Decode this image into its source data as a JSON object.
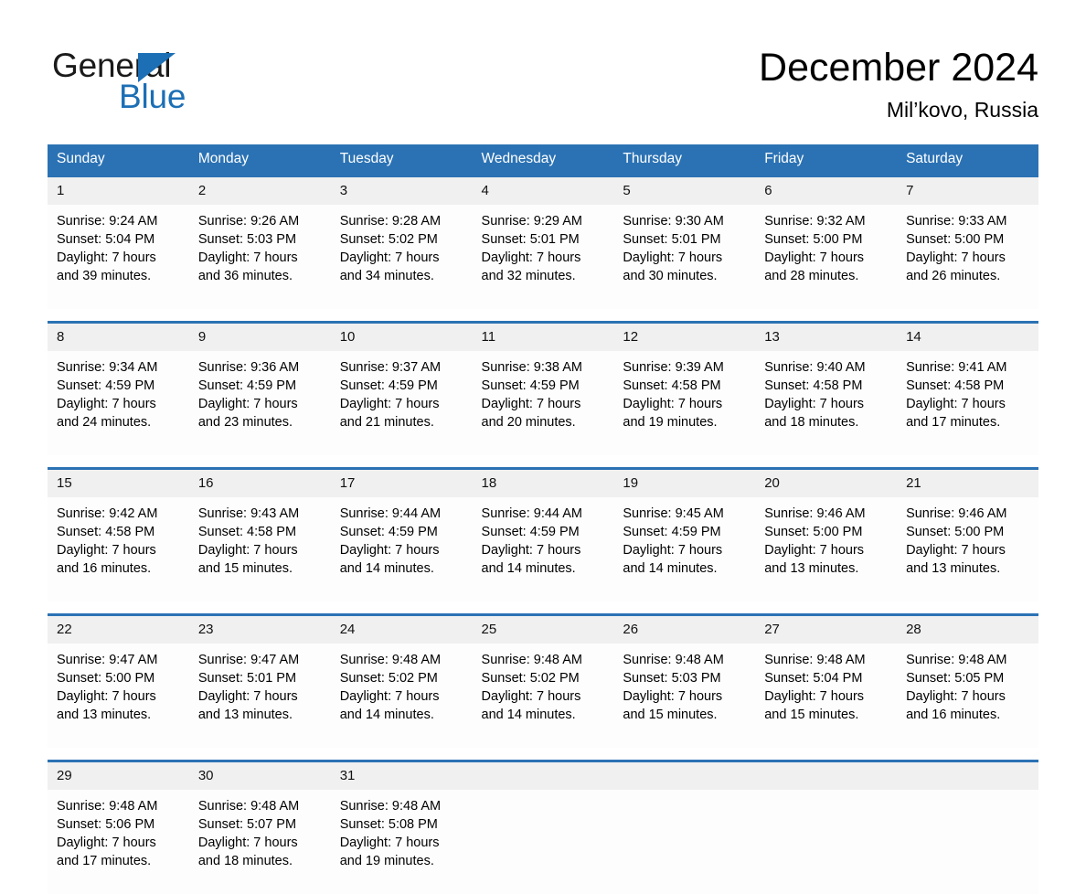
{
  "brand": {
    "word_top": "General",
    "word_bottom": "Blue",
    "triangle_color": "#1c6fb5",
    "icon": "general-blue-logo"
  },
  "header": {
    "title": "December 2024",
    "location": "Mil’kovo, Russia"
  },
  "theme": {
    "header_blue": "#2b72b4",
    "daynum_band": "#f0f0f0",
    "cell_bg": "#fdfdfd",
    "text": "#000000"
  },
  "calendar": {
    "weekday_headers": [
      "Sunday",
      "Monday",
      "Tuesday",
      "Wednesday",
      "Thursday",
      "Friday",
      "Saturday"
    ],
    "weeks": [
      [
        {
          "day": "1",
          "sunrise": "Sunrise: 9:24 AM",
          "sunset": "Sunset: 5:04 PM",
          "daylight": "Daylight: 7 hours and 39 minutes."
        },
        {
          "day": "2",
          "sunrise": "Sunrise: 9:26 AM",
          "sunset": "Sunset: 5:03 PM",
          "daylight": "Daylight: 7 hours and 36 minutes."
        },
        {
          "day": "3",
          "sunrise": "Sunrise: 9:28 AM",
          "sunset": "Sunset: 5:02 PM",
          "daylight": "Daylight: 7 hours and 34 minutes."
        },
        {
          "day": "4",
          "sunrise": "Sunrise: 9:29 AM",
          "sunset": "Sunset: 5:01 PM",
          "daylight": "Daylight: 7 hours and 32 minutes."
        },
        {
          "day": "5",
          "sunrise": "Sunrise: 9:30 AM",
          "sunset": "Sunset: 5:01 PM",
          "daylight": "Daylight: 7 hours and 30 minutes."
        },
        {
          "day": "6",
          "sunrise": "Sunrise: 9:32 AM",
          "sunset": "Sunset: 5:00 PM",
          "daylight": "Daylight: 7 hours and 28 minutes."
        },
        {
          "day": "7",
          "sunrise": "Sunrise: 9:33 AM",
          "sunset": "Sunset: 5:00 PM",
          "daylight": "Daylight: 7 hours and 26 minutes."
        }
      ],
      [
        {
          "day": "8",
          "sunrise": "Sunrise: 9:34 AM",
          "sunset": "Sunset: 4:59 PM",
          "daylight": "Daylight: 7 hours and 24 minutes."
        },
        {
          "day": "9",
          "sunrise": "Sunrise: 9:36 AM",
          "sunset": "Sunset: 4:59 PM",
          "daylight": "Daylight: 7 hours and 23 minutes."
        },
        {
          "day": "10",
          "sunrise": "Sunrise: 9:37 AM",
          "sunset": "Sunset: 4:59 PM",
          "daylight": "Daylight: 7 hours and 21 minutes."
        },
        {
          "day": "11",
          "sunrise": "Sunrise: 9:38 AM",
          "sunset": "Sunset: 4:59 PM",
          "daylight": "Daylight: 7 hours and 20 minutes."
        },
        {
          "day": "12",
          "sunrise": "Sunrise: 9:39 AM",
          "sunset": "Sunset: 4:58 PM",
          "daylight": "Daylight: 7 hours and 19 minutes."
        },
        {
          "day": "13",
          "sunrise": "Sunrise: 9:40 AM",
          "sunset": "Sunset: 4:58 PM",
          "daylight": "Daylight: 7 hours and 18 minutes."
        },
        {
          "day": "14",
          "sunrise": "Sunrise: 9:41 AM",
          "sunset": "Sunset: 4:58 PM",
          "daylight": "Daylight: 7 hours and 17 minutes."
        }
      ],
      [
        {
          "day": "15",
          "sunrise": "Sunrise: 9:42 AM",
          "sunset": "Sunset: 4:58 PM",
          "daylight": "Daylight: 7 hours and 16 minutes."
        },
        {
          "day": "16",
          "sunrise": "Sunrise: 9:43 AM",
          "sunset": "Sunset: 4:58 PM",
          "daylight": "Daylight: 7 hours and 15 minutes."
        },
        {
          "day": "17",
          "sunrise": "Sunrise: 9:44 AM",
          "sunset": "Sunset: 4:59 PM",
          "daylight": "Daylight: 7 hours and 14 minutes."
        },
        {
          "day": "18",
          "sunrise": "Sunrise: 9:44 AM",
          "sunset": "Sunset: 4:59 PM",
          "daylight": "Daylight: 7 hours and 14 minutes."
        },
        {
          "day": "19",
          "sunrise": "Sunrise: 9:45 AM",
          "sunset": "Sunset: 4:59 PM",
          "daylight": "Daylight: 7 hours and 14 minutes."
        },
        {
          "day": "20",
          "sunrise": "Sunrise: 9:46 AM",
          "sunset": "Sunset: 5:00 PM",
          "daylight": "Daylight: 7 hours and 13 minutes."
        },
        {
          "day": "21",
          "sunrise": "Sunrise: 9:46 AM",
          "sunset": "Sunset: 5:00 PM",
          "daylight": "Daylight: 7 hours and 13 minutes."
        }
      ],
      [
        {
          "day": "22",
          "sunrise": "Sunrise: 9:47 AM",
          "sunset": "Sunset: 5:00 PM",
          "daylight": "Daylight: 7 hours and 13 minutes."
        },
        {
          "day": "23",
          "sunrise": "Sunrise: 9:47 AM",
          "sunset": "Sunset: 5:01 PM",
          "daylight": "Daylight: 7 hours and 13 minutes."
        },
        {
          "day": "24",
          "sunrise": "Sunrise: 9:48 AM",
          "sunset": "Sunset: 5:02 PM",
          "daylight": "Daylight: 7 hours and 14 minutes."
        },
        {
          "day": "25",
          "sunrise": "Sunrise: 9:48 AM",
          "sunset": "Sunset: 5:02 PM",
          "daylight": "Daylight: 7 hours and 14 minutes."
        },
        {
          "day": "26",
          "sunrise": "Sunrise: 9:48 AM",
          "sunset": "Sunset: 5:03 PM",
          "daylight": "Daylight: 7 hours and 15 minutes."
        },
        {
          "day": "27",
          "sunrise": "Sunrise: 9:48 AM",
          "sunset": "Sunset: 5:04 PM",
          "daylight": "Daylight: 7 hours and 15 minutes."
        },
        {
          "day": "28",
          "sunrise": "Sunrise: 9:48 AM",
          "sunset": "Sunset: 5:05 PM",
          "daylight": "Daylight: 7 hours and 16 minutes."
        }
      ],
      [
        {
          "day": "29",
          "sunrise": "Sunrise: 9:48 AM",
          "sunset": "Sunset: 5:06 PM",
          "daylight": "Daylight: 7 hours and 17 minutes."
        },
        {
          "day": "30",
          "sunrise": "Sunrise: 9:48 AM",
          "sunset": "Sunset: 5:07 PM",
          "daylight": "Daylight: 7 hours and 18 minutes."
        },
        {
          "day": "31",
          "sunrise": "Sunrise: 9:48 AM",
          "sunset": "Sunset: 5:08 PM",
          "daylight": "Daylight: 7 hours and 19 minutes."
        },
        {
          "day": "",
          "sunrise": "",
          "sunset": "",
          "daylight": ""
        },
        {
          "day": "",
          "sunrise": "",
          "sunset": "",
          "daylight": ""
        },
        {
          "day": "",
          "sunrise": "",
          "sunset": "",
          "daylight": ""
        },
        {
          "day": "",
          "sunrise": "",
          "sunset": "",
          "daylight": ""
        }
      ]
    ]
  }
}
